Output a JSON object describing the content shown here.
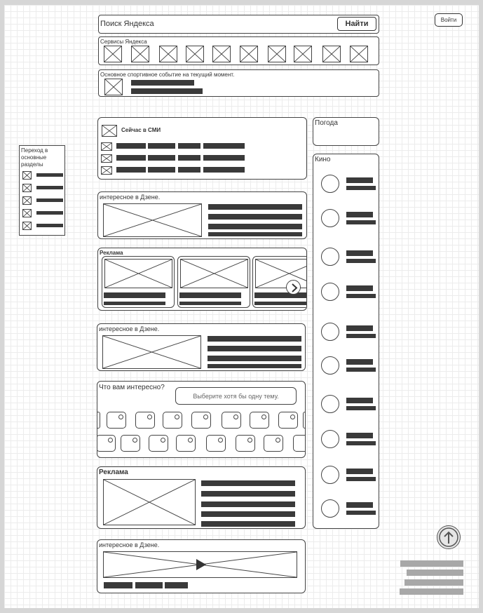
{
  "header": {
    "search_placeholder": "Поиск Яндекса",
    "search_button": "Найти",
    "login_button": "Войти"
  },
  "services": {
    "title": "Сервисы Яндекса",
    "count": 10
  },
  "sport": {
    "text": "Основное спортивное событие на текущий момент."
  },
  "side_nav": {
    "title": "Переход в основные разделы",
    "items": 5
  },
  "news": {
    "title": "Сейчас в СМИ"
  },
  "zen_1": {
    "title": "интересное в Дзене."
  },
  "ads_carousel": {
    "title": "Реклама"
  },
  "zen_2": {
    "title": "интересное в Дзене."
  },
  "interests": {
    "title": "Что вам интересно?",
    "hint": "Выберите хотя бы одну тему."
  },
  "ad_block": {
    "title": "Реклама"
  },
  "zen_video": {
    "title": "интересное в Дзене."
  },
  "weather": {
    "title": "Погода"
  },
  "cinema": {
    "title": "Кино",
    "items": 10
  },
  "colors": {
    "line": "#444444",
    "bar": "#3a3a3a",
    "footer_bar": "#a8a8a8",
    "grid": "#ececec"
  },
  "icons": {
    "scroll_top": "arrow-up-circle-icon",
    "carousel_next": "chevron-right-icon"
  }
}
